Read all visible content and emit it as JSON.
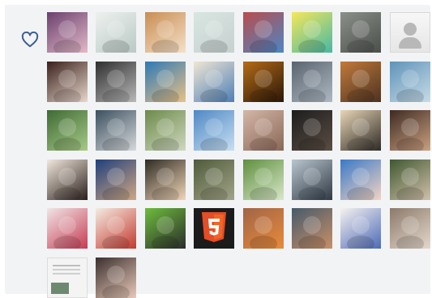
{
  "like_icon": "heart-outline-icon",
  "avatars": [
    [
      "#6a3f6e",
      "#e3b9c8"
    ],
    [
      "#eef1ee",
      "#b9c9c5"
    ],
    [
      "#c98d53",
      "#f4e1c8"
    ],
    [
      "#d8e6e2",
      "#c7d1cf"
    ],
    [
      "#b94d4b",
      "#4b86c5"
    ],
    [
      "#f5e75a",
      "#46b8a4"
    ],
    [
      "#8c908a",
      "#4b4f4b"
    ],
    [
      "#f1f1f1",
      "#c9c9c9"
    ],
    [
      "#3a1f1a",
      "#e7d7cc"
    ],
    [
      "#2e2e2e",
      "#b8b8b8"
    ],
    [
      "#2d79b6",
      "#e8c184"
    ],
    [
      "#f0e6d4",
      "#4e7fb6"
    ],
    [
      "#b56c18",
      "#2a1608"
    ],
    [
      "#5a6470",
      "#aeb8c2"
    ],
    [
      "#c27a3b",
      "#4c3321"
    ],
    [
      "#5f93b8",
      "#c7dbe8"
    ],
    [
      "#3f6a35",
      "#a7c986"
    ],
    [
      "#3b4f5e",
      "#d6d9dc"
    ],
    [
      "#6c8a4a",
      "#cfd8c0"
    ],
    [
      "#4f88c4",
      "#c7dff2"
    ],
    [
      "#d4b7a7",
      "#8a6757"
    ],
    [
      "#1d1d1d",
      "#5a4d43"
    ],
    [
      "#e8d6b6",
      "#2e2a26"
    ],
    [
      "#3d2a22",
      "#caa080"
    ],
    [
      "#f3e8de",
      "#2b201b"
    ],
    [
      "#1f3f7a",
      "#d0a783"
    ],
    [
      "#2e2a22",
      "#f0d6b8"
    ],
    [
      "#4f5b3b",
      "#a2a488"
    ],
    [
      "#5f8f3f",
      "#d8e7c8"
    ],
    [
      "#b9c5cf",
      "#2f3a45"
    ],
    [
      "#3a79c7",
      "#f1d4c3"
    ],
    [
      "#3f5731",
      "#d2c0aa"
    ],
    [
      "#f0e6e6",
      "#c73b53"
    ],
    [
      "#f3ece3",
      "#c5392e"
    ],
    [
      "#6dbd3c",
      "#2c2c2c"
    ],
    [
      "#1b1b1b",
      "#e44d26"
    ],
    [
      "#a16546",
      "#e88a3b"
    ],
    [
      "#465a6b",
      "#c98f66"
    ],
    [
      "#f6f2ef",
      "#4d6ab8"
    ],
    [
      "#8c7a6a",
      "#e4d8cc"
    ],
    [
      "#f4f4f4",
      "#6d8a70"
    ],
    [
      "#3a2f2e",
      "#e9c9b8"
    ]
  ]
}
